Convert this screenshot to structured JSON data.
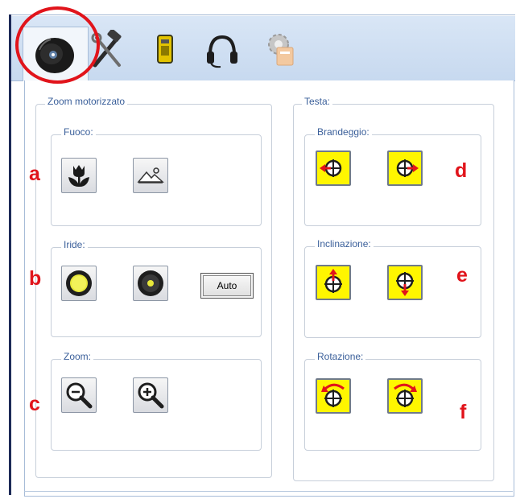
{
  "tabs": [
    {
      "icon": "camera-icon"
    },
    {
      "icon": "tools-icon"
    },
    {
      "icon": "battery-icon"
    },
    {
      "icon": "headset-icon"
    },
    {
      "icon": "settings-icon"
    }
  ],
  "zoom_group": {
    "title": "Zoom motorizzato",
    "focus": {
      "title": "Fuoco:",
      "buttons": [
        "flower-icon",
        "mountain-icon"
      ]
    },
    "iris": {
      "title": "Iride:",
      "buttons": [
        "iris-open-icon",
        "iris-closed-icon"
      ],
      "auto_label": "Auto"
    },
    "zoom": {
      "title": "Zoom:",
      "buttons": [
        "zoom-out-icon",
        "zoom-in-icon"
      ]
    }
  },
  "head_group": {
    "title": "Testa:",
    "pan": {
      "title": "Brandeggio:",
      "buttons": [
        "pan-left-icon",
        "pan-right-icon"
      ]
    },
    "tilt": {
      "title": "Inclinazione:",
      "buttons": [
        "tilt-up-icon",
        "tilt-down-icon"
      ]
    },
    "rotation": {
      "title": "Rotazione:",
      "buttons": [
        "rotate-left-icon",
        "rotate-right-icon"
      ]
    }
  },
  "callouts": [
    "a",
    "b",
    "c",
    "d",
    "e",
    "f"
  ],
  "colors": {
    "callout": "#e1141b",
    "highlight": "#fff600",
    "legend": "#3a5f9a",
    "arrow": "#e1141b"
  }
}
